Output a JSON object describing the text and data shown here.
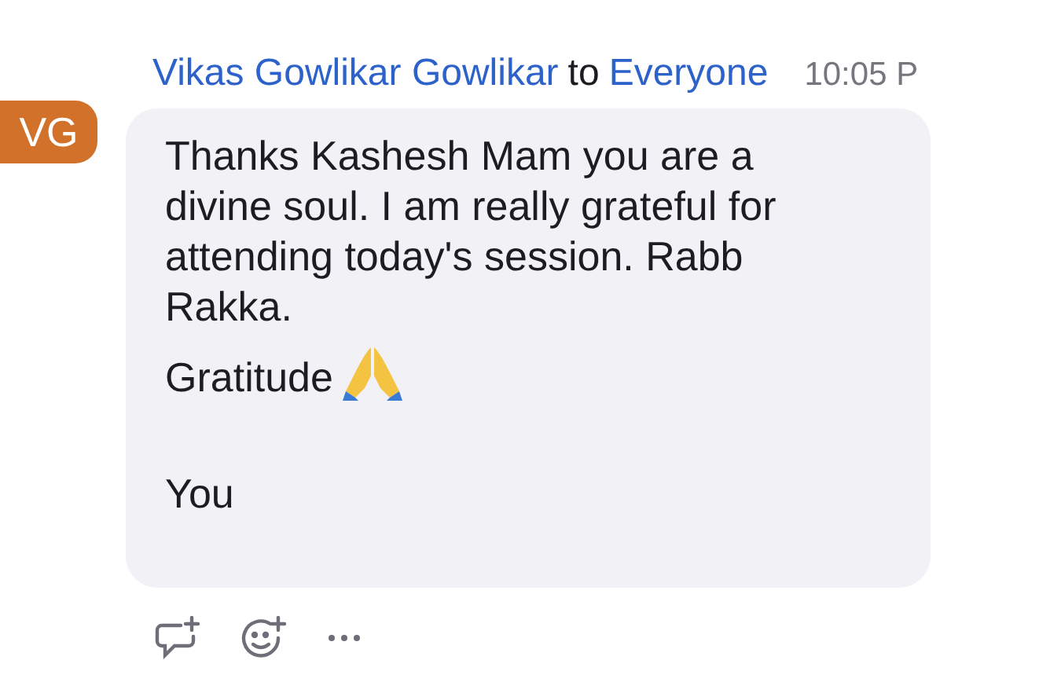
{
  "message": {
    "sender": "Vikas Gowlikar Gowlikar",
    "connector": "to",
    "recipient": "Everyone",
    "time": "10:05 P",
    "avatar": {
      "initials": "VG",
      "color": "#d2712a"
    },
    "paragraphs": [
      {
        "text": "Thanks Kashesh Mam you are a divine soul. I am really grateful for attending today's session. Rabb Rakka."
      },
      {
        "text": "Gratitude",
        "kind": "with-emoji"
      },
      {
        "text": "You"
      }
    ]
  }
}
